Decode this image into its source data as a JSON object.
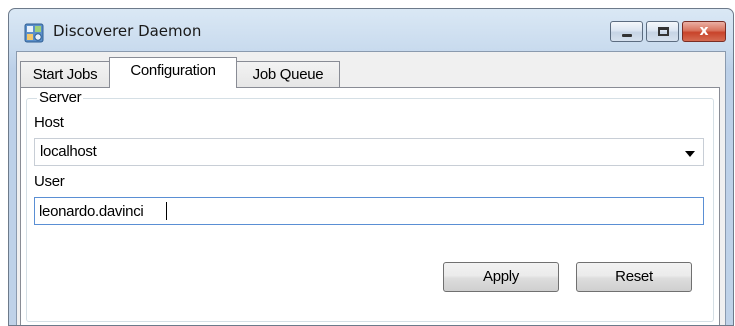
{
  "window": {
    "title": "Discoverer Daemon",
    "icon": "app-icon"
  },
  "caption_buttons": {
    "minimize": "minimize-icon",
    "maximize": "maximize-icon",
    "close": "close-icon",
    "close_glyph": "x",
    "close_color": "#c8432a"
  },
  "tabs": [
    {
      "label": "Start Jobs",
      "selected": false
    },
    {
      "label": "Configuration",
      "selected": true
    },
    {
      "label": "Job Queue",
      "selected": false
    }
  ],
  "server_group": {
    "title": "Server",
    "host": {
      "label": "Host",
      "value": "localhost"
    },
    "user": {
      "label": "User",
      "value": "leonardo.davinci"
    }
  },
  "actions": {
    "apply_label": "Apply",
    "reset_label": "Reset"
  },
  "colors": {
    "focus_border": "#5a8fd4",
    "titlebar": "#c9dbee"
  }
}
